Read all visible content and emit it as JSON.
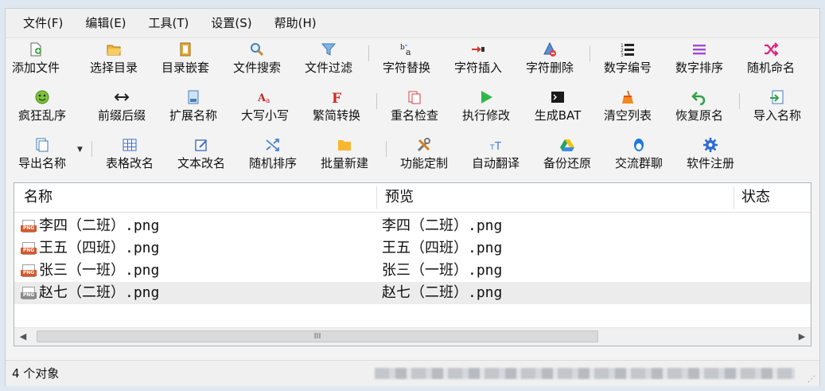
{
  "menu": [
    "文件(F)",
    "编辑(E)",
    "工具(T)",
    "设置(S)",
    "帮助(H)"
  ],
  "toolbar": {
    "row1": [
      "添加文件",
      "选择目录",
      "目录嵌套",
      "文件搜索",
      "文件过滤",
      "字符替换",
      "字符插入",
      "字符删除",
      "数字编号",
      "数字排序",
      "随机命名"
    ],
    "row2": [
      "疯狂乱序",
      "前缀后缀",
      "扩展名称",
      "大写小写",
      "繁简转换",
      "重名检查",
      "执行修改",
      "生成BAT",
      "清空列表",
      "恢复原名",
      "导入名称"
    ],
    "row3": [
      "导出名称",
      "表格改名",
      "文本改名",
      "随机排序",
      "批量新建",
      "功能定制",
      "自动翻译",
      "备份还原",
      "交流群聊",
      "软件注册"
    ]
  },
  "list": {
    "columns": [
      "名称",
      "预览",
      "状态"
    ],
    "rows": [
      {
        "name": "李四（二班）.png",
        "preview": "李四（二班）.png",
        "status": ""
      },
      {
        "name": "王五（四班）.png",
        "preview": "王五（四班）.png",
        "status": ""
      },
      {
        "name": "张三（一班）.png",
        "preview": "张三（一班）.png",
        "status": ""
      },
      {
        "name": "赵七（二班）.png",
        "preview": "赵七（二班）.png",
        "status": ""
      }
    ],
    "file_icon_tag": "PNG",
    "scroll_thumb_grip": "III"
  },
  "status": {
    "count_text": "4 个对象"
  },
  "colors": {
    "accent_red": "#d7562a",
    "selected_row": "#ececec"
  }
}
